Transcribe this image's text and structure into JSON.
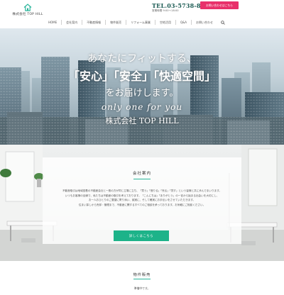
{
  "brand": {
    "name": "株式会社 TOP HILL",
    "accent": "#2ab59b"
  },
  "contact": {
    "tel": "TEL.03-5738-8474",
    "hours": "営業時間 9:00〜18:00",
    "button_label": "お問い合わせはこちら",
    "button_color": "#e8306a"
  },
  "nav": {
    "items": [
      "HOME",
      "会社案内",
      "不動産情報",
      "物件販売",
      "リフォーム事業",
      "空地活用",
      "Q&A",
      "お問い合わせ"
    ],
    "search_icon": "search-icon"
  },
  "hero": {
    "line1": "あなたにフィットする、",
    "line2": "「安心」「安全」「快適空間」",
    "line3": "をお届けします。",
    "line4": "only one for you",
    "line5": "株式会社 TOP HILL"
  },
  "company": {
    "title": "会社案内",
    "body": [
      "不動産取引は地域密着の不動産会社と一般の方が同じ立場に立ち、「買う」「借りる」「売る」「貸す」という皆様と共に歩んでまいります。",
      "いつもお客様の目線で、私たちは不動産の取引を考えております。「こんにちは」「ありがとう」の一言から始まる出会いを大切にし、",
      "お一人おひとりのご要望に寄り添い、誠実に、そして確実にお手伝いをさせていただきます。",
      "住まい探しから売却・管理まで、不動産に関するすべてのご相談を承っております。お気軽にご相談ください。"
    ],
    "button_label": "詳しくはこちら",
    "button_color": "#1db389"
  },
  "property": {
    "title": "物件販売",
    "text": "準備中です。"
  }
}
